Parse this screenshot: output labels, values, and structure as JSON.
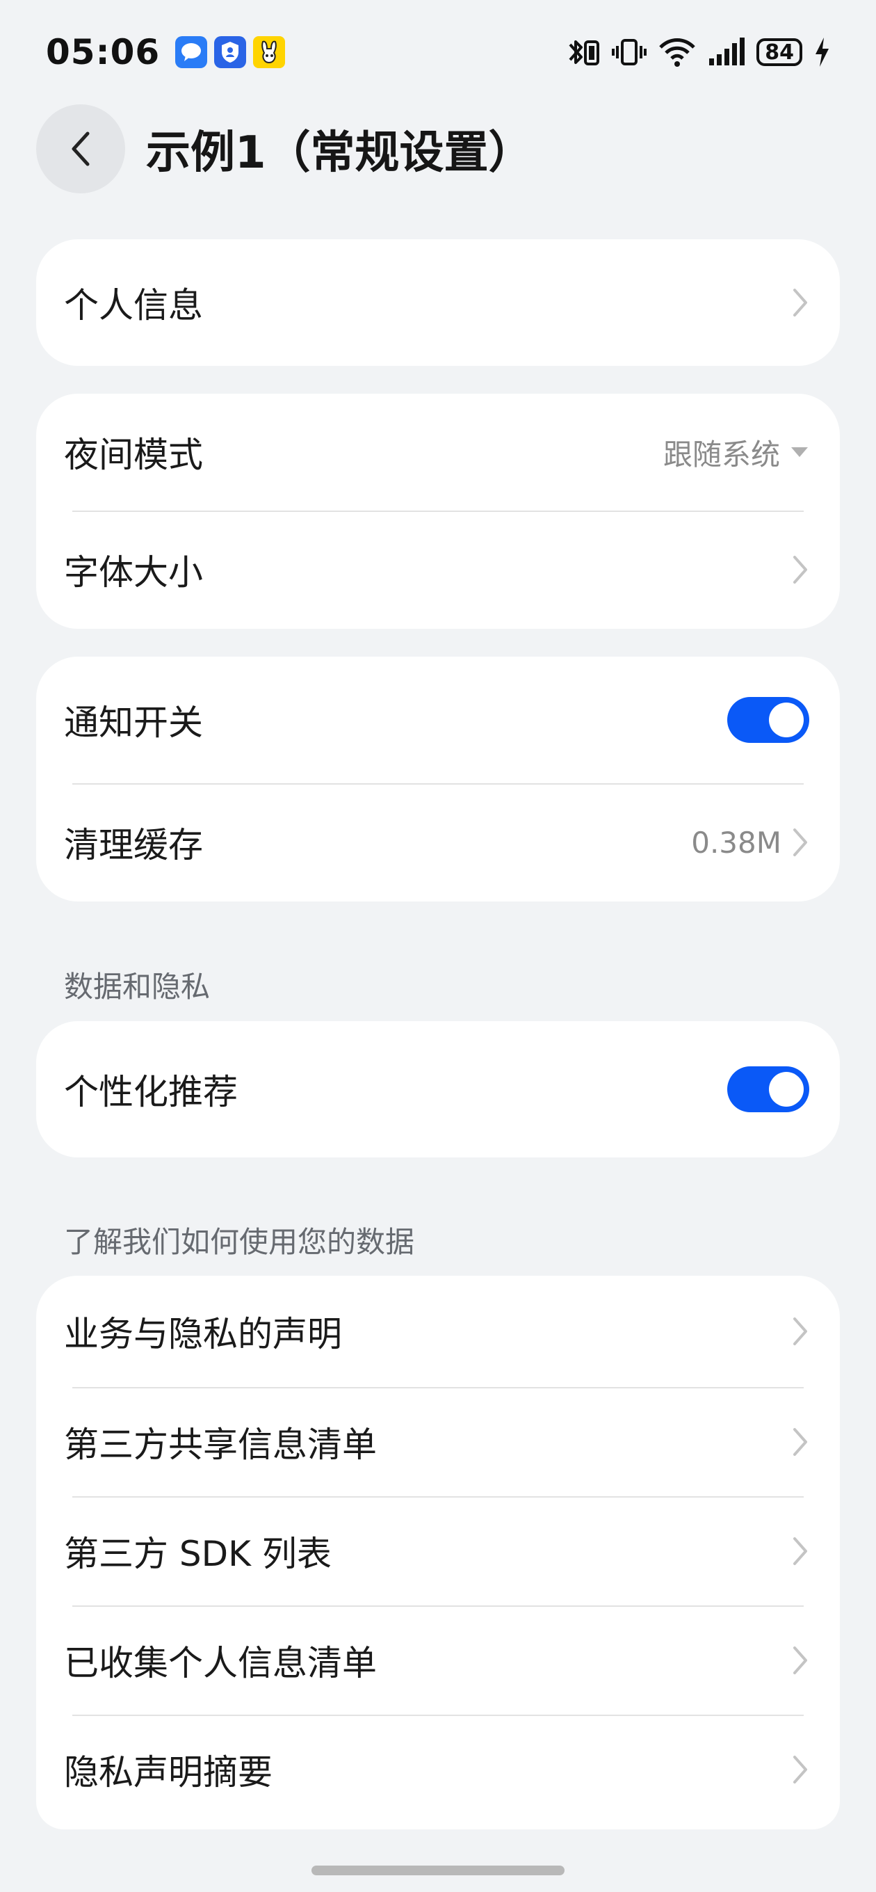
{
  "status_bar": {
    "time": "05:06",
    "battery": "84",
    "icons": [
      "chat-app-icon",
      "shield-app-icon",
      "yellow-app-icon",
      "bluetooth-icon",
      "vibrate-icon",
      "wifi-icon",
      "signal-icon",
      "battery-icon",
      "charging-icon"
    ]
  },
  "header": {
    "title": "示例1（常规设置）",
    "back_icon": "chevron-left-icon"
  },
  "colors": {
    "background": "#f1f3f5",
    "card": "#ffffff",
    "accent": "#0a59f7",
    "secondary_text": "#8a8a8a"
  },
  "groups": {
    "personal": {
      "items": [
        {
          "label": "个人信息"
        }
      ]
    },
    "display": {
      "items": [
        {
          "label": "夜间模式",
          "value": "跟随系统"
        },
        {
          "label": "字体大小"
        }
      ]
    },
    "general": {
      "items": [
        {
          "label": "通知开关",
          "toggle": true
        },
        {
          "label": "清理缓存",
          "value": "0.38M"
        }
      ]
    },
    "privacy": {
      "title": "数据和隐私",
      "items": [
        {
          "label": "个性化推荐",
          "toggle": true
        }
      ]
    },
    "data_usage": {
      "title": "了解我们如何使用您的数据",
      "items": [
        {
          "label": "业务与隐私的声明"
        },
        {
          "label": "第三方共享信息清单"
        },
        {
          "label": "第三方 SDK 列表"
        },
        {
          "label": "已收集个人信息清单"
        },
        {
          "label": "隐私声明摘要"
        }
      ]
    }
  }
}
